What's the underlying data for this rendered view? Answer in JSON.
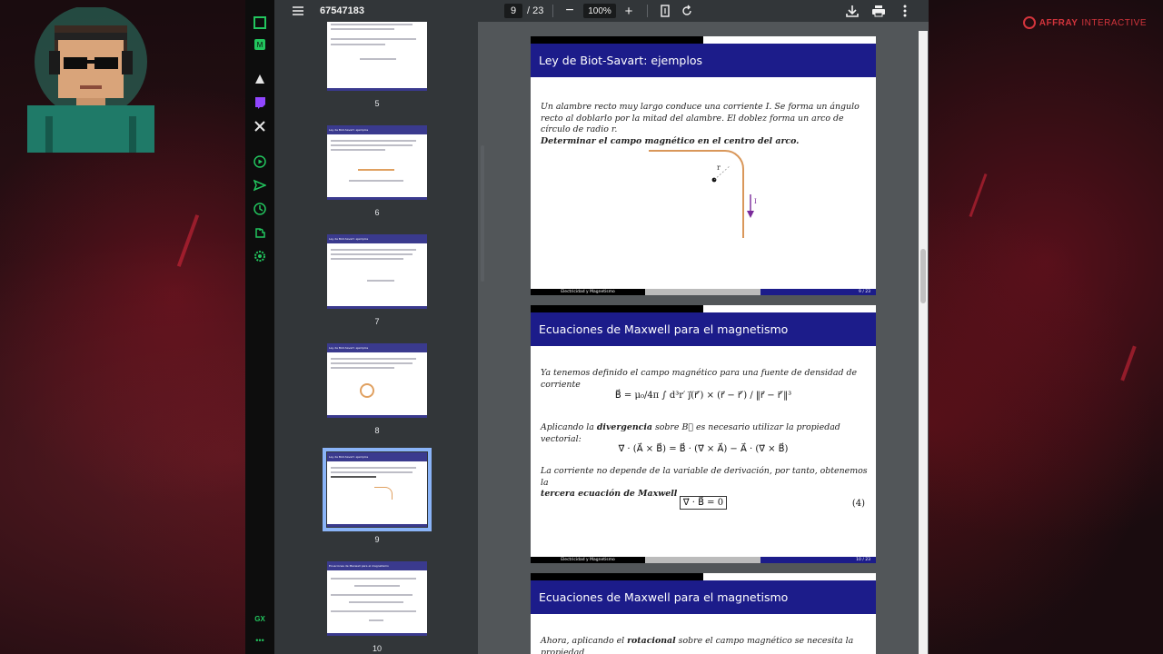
{
  "toolbar": {
    "document_title": "67547183",
    "current_page": "9",
    "total_pages": "/ 23",
    "zoom": "100%",
    "minus_label": "−",
    "plus_label": "+"
  },
  "thumbnails": [
    {
      "num": "5"
    },
    {
      "num": "6"
    },
    {
      "num": "7"
    },
    {
      "num": "8"
    },
    {
      "num": "9"
    },
    {
      "num": "10"
    }
  ],
  "brand": {
    "name": "AFFRAY",
    "suffix": "INTERACTIVE"
  },
  "gx_sidebar": {
    "bottom_label": "GX",
    "dots": "•••"
  },
  "pages": [
    {
      "title": "Ley de Biot-Savart: ejemplos",
      "paragraph": "Un alambre recto muy largo conduce una corriente I. Se forma un ángulo recto al doblarlo por la mitad del alambre. El doblez forma un arco de círculo de radio r.",
      "bold": "Determinar el campo magnético en el centro del arco.",
      "label_r": "r",
      "label_i": "I",
      "footer_left": "Electricidad y Magnetismo",
      "footer_right": "9 / 23"
    },
    {
      "title": "Ecuaciones de Maxwell para el magnetismo",
      "p1": "Ya tenemos definido el campo magnético para una fuente de densidad de corriente",
      "eq1": "B⃗ = μ₀/4π ∫ d³r′ j⃗(r⃗′) × (r⃗ − r⃗′) / ‖r⃗ − r⃗′‖³",
      "p2_a": "Aplicando la ",
      "p2_bold": "divergencia",
      "p2_b": " sobre B⃗ es necesario utilizar la propiedad vectorial:",
      "eq2": "∇⃗ · (A⃗ × B⃗) = B⃗ · (∇⃗ × A⃗) − A⃗ · (∇⃗ × B⃗)",
      "p3": "La corriente no depende de la variable de derivación, por tanto, obtenemos la",
      "p3_bold": "tercera ecuación de Maxwell",
      "eq3": "∇⃗ · B⃗ = 0",
      "eq3_num": "(4)",
      "footer_left": "Electricidad y Magnetismo",
      "footer_right": "10 / 23"
    },
    {
      "title": "Ecuaciones de Maxwell para el magnetismo",
      "p1_a": "Ahora, aplicando el ",
      "p1_bold": "rotacional",
      "p1_b": " sobre el campo magnético se necesita la propiedad"
    }
  ]
}
